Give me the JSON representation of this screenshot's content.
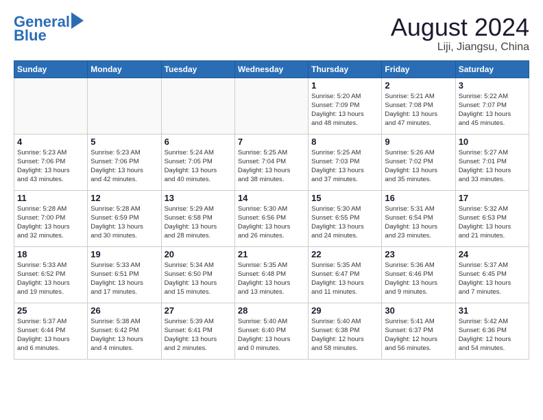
{
  "header": {
    "logo_line1": "General",
    "logo_line2": "Blue",
    "title": "August 2024",
    "subtitle": "Liji, Jiangsu, China"
  },
  "days_of_week": [
    "Sunday",
    "Monday",
    "Tuesday",
    "Wednesday",
    "Thursday",
    "Friday",
    "Saturday"
  ],
  "weeks": [
    [
      {
        "day": "",
        "info": ""
      },
      {
        "day": "",
        "info": ""
      },
      {
        "day": "",
        "info": ""
      },
      {
        "day": "",
        "info": ""
      },
      {
        "day": "1",
        "info": "Sunrise: 5:20 AM\nSunset: 7:09 PM\nDaylight: 13 hours\nand 48 minutes."
      },
      {
        "day": "2",
        "info": "Sunrise: 5:21 AM\nSunset: 7:08 PM\nDaylight: 13 hours\nand 47 minutes."
      },
      {
        "day": "3",
        "info": "Sunrise: 5:22 AM\nSunset: 7:07 PM\nDaylight: 13 hours\nand 45 minutes."
      }
    ],
    [
      {
        "day": "4",
        "info": "Sunrise: 5:23 AM\nSunset: 7:06 PM\nDaylight: 13 hours\nand 43 minutes."
      },
      {
        "day": "5",
        "info": "Sunrise: 5:23 AM\nSunset: 7:06 PM\nDaylight: 13 hours\nand 42 minutes."
      },
      {
        "day": "6",
        "info": "Sunrise: 5:24 AM\nSunset: 7:05 PM\nDaylight: 13 hours\nand 40 minutes."
      },
      {
        "day": "7",
        "info": "Sunrise: 5:25 AM\nSunset: 7:04 PM\nDaylight: 13 hours\nand 38 minutes."
      },
      {
        "day": "8",
        "info": "Sunrise: 5:25 AM\nSunset: 7:03 PM\nDaylight: 13 hours\nand 37 minutes."
      },
      {
        "day": "9",
        "info": "Sunrise: 5:26 AM\nSunset: 7:02 PM\nDaylight: 13 hours\nand 35 minutes."
      },
      {
        "day": "10",
        "info": "Sunrise: 5:27 AM\nSunset: 7:01 PM\nDaylight: 13 hours\nand 33 minutes."
      }
    ],
    [
      {
        "day": "11",
        "info": "Sunrise: 5:28 AM\nSunset: 7:00 PM\nDaylight: 13 hours\nand 32 minutes."
      },
      {
        "day": "12",
        "info": "Sunrise: 5:28 AM\nSunset: 6:59 PM\nDaylight: 13 hours\nand 30 minutes."
      },
      {
        "day": "13",
        "info": "Sunrise: 5:29 AM\nSunset: 6:58 PM\nDaylight: 13 hours\nand 28 minutes."
      },
      {
        "day": "14",
        "info": "Sunrise: 5:30 AM\nSunset: 6:56 PM\nDaylight: 13 hours\nand 26 minutes."
      },
      {
        "day": "15",
        "info": "Sunrise: 5:30 AM\nSunset: 6:55 PM\nDaylight: 13 hours\nand 24 minutes."
      },
      {
        "day": "16",
        "info": "Sunrise: 5:31 AM\nSunset: 6:54 PM\nDaylight: 13 hours\nand 23 minutes."
      },
      {
        "day": "17",
        "info": "Sunrise: 5:32 AM\nSunset: 6:53 PM\nDaylight: 13 hours\nand 21 minutes."
      }
    ],
    [
      {
        "day": "18",
        "info": "Sunrise: 5:33 AM\nSunset: 6:52 PM\nDaylight: 13 hours\nand 19 minutes."
      },
      {
        "day": "19",
        "info": "Sunrise: 5:33 AM\nSunset: 6:51 PM\nDaylight: 13 hours\nand 17 minutes."
      },
      {
        "day": "20",
        "info": "Sunrise: 5:34 AM\nSunset: 6:50 PM\nDaylight: 13 hours\nand 15 minutes."
      },
      {
        "day": "21",
        "info": "Sunrise: 5:35 AM\nSunset: 6:48 PM\nDaylight: 13 hours\nand 13 minutes."
      },
      {
        "day": "22",
        "info": "Sunrise: 5:35 AM\nSunset: 6:47 PM\nDaylight: 13 hours\nand 11 minutes."
      },
      {
        "day": "23",
        "info": "Sunrise: 5:36 AM\nSunset: 6:46 PM\nDaylight: 13 hours\nand 9 minutes."
      },
      {
        "day": "24",
        "info": "Sunrise: 5:37 AM\nSunset: 6:45 PM\nDaylight: 13 hours\nand 7 minutes."
      }
    ],
    [
      {
        "day": "25",
        "info": "Sunrise: 5:37 AM\nSunset: 6:44 PM\nDaylight: 13 hours\nand 6 minutes."
      },
      {
        "day": "26",
        "info": "Sunrise: 5:38 AM\nSunset: 6:42 PM\nDaylight: 13 hours\nand 4 minutes."
      },
      {
        "day": "27",
        "info": "Sunrise: 5:39 AM\nSunset: 6:41 PM\nDaylight: 13 hours\nand 2 minutes."
      },
      {
        "day": "28",
        "info": "Sunrise: 5:40 AM\nSunset: 6:40 PM\nDaylight: 13 hours\nand 0 minutes."
      },
      {
        "day": "29",
        "info": "Sunrise: 5:40 AM\nSunset: 6:38 PM\nDaylight: 12 hours\nand 58 minutes."
      },
      {
        "day": "30",
        "info": "Sunrise: 5:41 AM\nSunset: 6:37 PM\nDaylight: 12 hours\nand 56 minutes."
      },
      {
        "day": "31",
        "info": "Sunrise: 5:42 AM\nSunset: 6:36 PM\nDaylight: 12 hours\nand 54 minutes."
      }
    ]
  ]
}
